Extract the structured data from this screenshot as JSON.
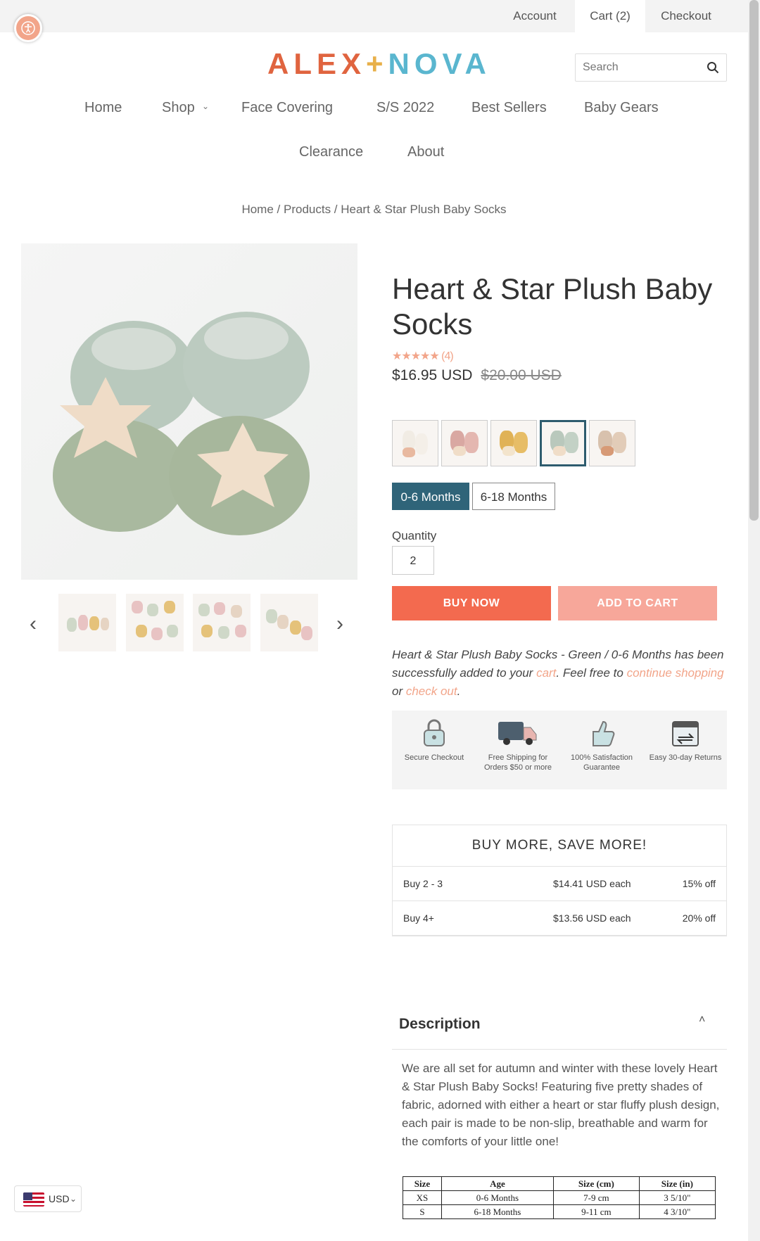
{
  "topbar": {
    "account": "Account",
    "cart": "Cart (2)",
    "checkout": "Checkout"
  },
  "brand": {
    "part1": "ALEX",
    "plus": "+",
    "part2": "NOVA",
    "colors": {
      "alex": "#e0643f",
      "plus": "#e8b04a",
      "nova": "#5ab6cf"
    }
  },
  "search": {
    "placeholder": "Search"
  },
  "nav": {
    "items": [
      "Home",
      "Shop",
      "Face Covering",
      "S/S 2022",
      "Best Sellers",
      "Baby Gears",
      "Clearance",
      "About"
    ]
  },
  "breadcrumb": {
    "home": "Home",
    "products": "Products",
    "current": "Heart & Star Plush Baby Socks"
  },
  "product": {
    "title": "Heart & Star Plush Baby Socks",
    "stars": "★★★★★",
    "review_count": "(4)",
    "price": "$16.95 USD",
    "compare_price": "$20.00 USD",
    "sizes": [
      "0-6 Months",
      "6-18 Months"
    ],
    "selected_size": "0-6 Months",
    "quantity_label": "Quantity",
    "quantity": "2",
    "buy_now": "BUY NOW",
    "add_to_cart": "ADD TO CART"
  },
  "message": {
    "pre": "Heart & Star Plush Baby Socks - Green / 0-6 Months has been successfully added to your ",
    "cart": "cart",
    "mid": ". Feel free to ",
    "continue": "continue shopping",
    "or": " or ",
    "checkout": "check out",
    "end": "."
  },
  "trust": [
    "Secure Checkout",
    "Free Shipping for Orders $50 or more",
    "100% Satisfaction Guarantee",
    "Easy 30-day Returns"
  ],
  "bulk": {
    "title": "BUY MORE, SAVE MORE!",
    "rows": [
      {
        "qty": "Buy 2 - 3",
        "price": "$14.41 USD each",
        "off": "15% off"
      },
      {
        "qty": "Buy 4+",
        "price": "$13.56 USD each",
        "off": "20% off"
      }
    ]
  },
  "description": {
    "heading": "Description",
    "text": "We are all set for autumn and winter with these lovely Heart & Star Plush Baby Socks! Featuring five pretty shades of fabric, adorned with either a heart or star fluffy plush design, each pair is made to be non-slip, breathable and warm for the comforts of your little one!"
  },
  "size_table": {
    "headers": [
      "Size",
      "Age",
      "Size (cm)",
      "Size (in)"
    ],
    "rows": [
      [
        "XS",
        "0-6 Months",
        "7-9 cm",
        "3  5/10\""
      ],
      [
        "S",
        "6-18 Months",
        "9-11 cm",
        "4  3/10\""
      ]
    ]
  },
  "currency": {
    "code": "USD"
  },
  "colors": {
    "accent": "#f2a58a",
    "buy_now": "#f36a4f",
    "add_to_cart": "#f7a79a",
    "selected": "#2f6479"
  }
}
